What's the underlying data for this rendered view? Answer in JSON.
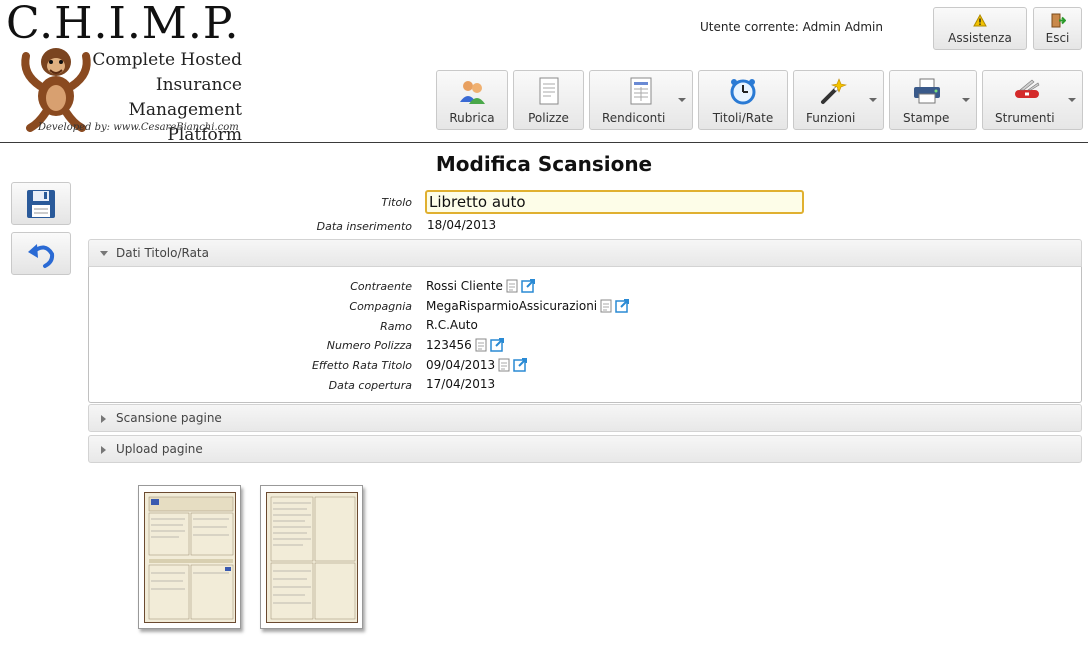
{
  "logo": {
    "title": "C.H.I.M.P.",
    "subtitle_lines": [
      "Complete Hosted",
      "Insurance",
      "Management Platform"
    ],
    "developer": "Developed by: www.CesareBianchi.com"
  },
  "header": {
    "user_label": "Utente corrente: Admin Admin",
    "assistenza": "Assistenza",
    "esci": "Esci"
  },
  "toolbar": [
    {
      "label": "Rubrica",
      "icon": "contacts-icon",
      "dropdown": false
    },
    {
      "label": "Polizze",
      "icon": "document-icon",
      "dropdown": false
    },
    {
      "label": "Rendiconti",
      "icon": "report-icon",
      "dropdown": true
    },
    {
      "label": "Titoli/Rate",
      "icon": "alarm-clock-icon",
      "dropdown": false
    },
    {
      "label": "Funzioni",
      "icon": "magic-wand-icon",
      "dropdown": true
    },
    {
      "label": "Stampe",
      "icon": "printer-icon",
      "dropdown": true
    },
    {
      "label": "Strumenti",
      "icon": "swiss-knife-icon",
      "dropdown": true
    }
  ],
  "page": {
    "title": "Modifica Scansione"
  },
  "form": {
    "titolo_label": "Titolo",
    "titolo_value": "Libretto auto",
    "data_inserimento_label": "Data inserimento",
    "data_inserimento_value": "18/04/2013"
  },
  "sections": {
    "dati": "Dati Titolo/Rata",
    "scansione": "Scansione pagine",
    "upload": "Upload pagine"
  },
  "dati": [
    {
      "label": "Contraente",
      "value": "Rossi Cliente",
      "links": true
    },
    {
      "label": "Compagnia",
      "value": "MegaRisparmioAssicurazioni",
      "links": true
    },
    {
      "label": "Ramo",
      "value": "R.C.Auto",
      "links": false
    },
    {
      "label": "Numero Polizza",
      "value": "123456",
      "links": true
    },
    {
      "label": "Effetto Rata Titolo",
      "value": "09/04/2013",
      "links": true
    },
    {
      "label": "Data copertura",
      "value": "17/04/2013",
      "links": false
    }
  ],
  "thumbnails": [
    {
      "name": "scanned-page-1"
    },
    {
      "name": "scanned-page-2"
    }
  ],
  "colors": {
    "accent_border": "#e0b030",
    "input_bg": "#fdfde8",
    "link_icon": "#2a8ad4"
  }
}
